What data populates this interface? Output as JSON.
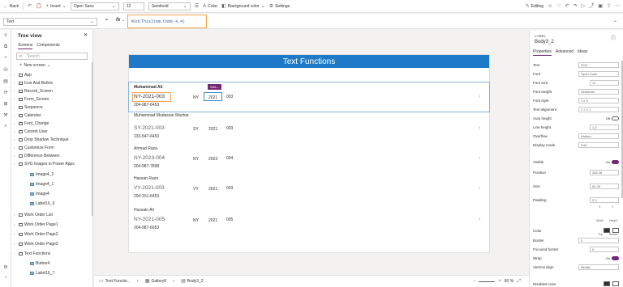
{
  "toolbar": {
    "back": "Back",
    "insert": "Insert",
    "font_value": "Open Sans",
    "size_value": "12",
    "weight_value": "Semibold",
    "color": "Color",
    "bg_color": "Background color",
    "settings": "Settings",
    "editing": "Editing"
  },
  "formula": {
    "property": "Text",
    "fx": "fx",
    "expression": "Mid(ThisItem.Code,4,4)"
  },
  "tree": {
    "title": "Tree view",
    "tabs": [
      "Screens",
      "Components"
    ],
    "search_placeholder": "Search",
    "new_screen": "New screen",
    "nodes": [
      {
        "label": "App",
        "type": "app"
      },
      {
        "label": "Icon And Button",
        "type": "screen"
      },
      {
        "label": "Record_Screen",
        "type": "screen"
      },
      {
        "label": "Form_Screen",
        "type": "screen"
      },
      {
        "label": "Sequence",
        "type": "screen"
      },
      {
        "label": "Calendar",
        "type": "screen"
      },
      {
        "label": "Font_Change",
        "type": "screen"
      },
      {
        "label": "Current User",
        "type": "screen"
      },
      {
        "label": "Drop Shadow Technique",
        "type": "screen"
      },
      {
        "label": "Customize Form",
        "type": "screen"
      },
      {
        "label": "Difference Between",
        "type": "screen"
      },
      {
        "label": "SVG Images in Power Apps",
        "type": "screen"
      },
      {
        "label": "Image4_2",
        "type": "image"
      },
      {
        "label": "Image4_1",
        "type": "image"
      },
      {
        "label": "Image4",
        "type": "image"
      },
      {
        "label": "Label16_6",
        "type": "image"
      },
      {
        "label": "Work Order List",
        "type": "screen"
      },
      {
        "label": "Work Order Page1",
        "type": "screen"
      },
      {
        "label": "Work Order Page2",
        "type": "screen"
      },
      {
        "label": "Work Order Page3",
        "type": "screen"
      },
      {
        "label": "Text Functions",
        "type": "screen"
      },
      {
        "label": "Button4",
        "type": "image"
      },
      {
        "label": "Label16_7",
        "type": "image"
      }
    ]
  },
  "screen": {
    "header": "Text Functions",
    "tag": "Edit",
    "rows": [
      {
        "name": "Muhammad Ali",
        "code": "NY-2021-003",
        "phone": "204-987-6453",
        "state": "NY",
        "year": "2021",
        "num": "003"
      },
      {
        "name": "Muhammad Mudassar Mazhar",
        "code": "SY-2021-003",
        "phone": "233-547-6453",
        "state": "SY",
        "year": "2021",
        "num": "003"
      },
      {
        "name": "Ahmad Raza",
        "code": "NY-2023-004",
        "phone": "204-987-7898",
        "state": "NY",
        "year": "2023",
        "num": "004"
      },
      {
        "name": "Hassan Raza",
        "code": "VY-2021-003",
        "phone": "204-151-6453",
        "state": "VY",
        "year": "2021",
        "num": "003"
      },
      {
        "name": "Hussain Ali",
        "code": "NY-2021-005",
        "phone": "204-987-6953",
        "state": "NY",
        "year": "2021",
        "num": "005"
      }
    ]
  },
  "status": {
    "crumbs": [
      "Text Functio...",
      "Gallery8",
      "Body3_2"
    ],
    "zoom": "60 %"
  },
  "props": {
    "type": "LABEL",
    "name": "Body3_2",
    "tabs": [
      "Properties",
      "Advanced",
      "Ideas"
    ],
    "rows": [
      {
        "label": "Text",
        "value": "2021"
      },
      {
        "label": "Font",
        "value": "Open Sans"
      },
      {
        "label": "Font size",
        "value": "12"
      },
      {
        "label": "Font weight",
        "value": "Semibold"
      },
      {
        "label": "Font style",
        "value": "/  U  S"
      },
      {
        "label": "Text alignment",
        "value": "≡ ≡ ≡ ≡"
      },
      {
        "label": "Auto height",
        "value": "Off"
      },
      {
        "label": "Line height",
        "value": "1.2"
      },
      {
        "label": "Overflow",
        "value": "Hidden"
      },
      {
        "label": "Display mode",
        "value": "Edit"
      },
      {
        "label": "Visible",
        "value": "On"
      },
      {
        "label": "Position",
        "value": "284  36"
      },
      {
        "label": "Size",
        "value": "64  28"
      },
      {
        "label": "Padding",
        "value": "0  0"
      },
      {
        "label": "Color",
        "value": ""
      },
      {
        "label": "Border",
        "value": "0"
      },
      {
        "label": "Focused border",
        "value": "0"
      },
      {
        "label": "Wrap",
        "value": "On"
      },
      {
        "label": "Vertical align",
        "value": "Middle"
      },
      {
        "label": "Disabled color",
        "value": ""
      }
    ],
    "sub_xy": [
      "X",
      "Y"
    ],
    "sub_wh": [
      "Width",
      "Height"
    ],
    "sub_tb": [
      "Top",
      "Bottom"
    ],
    "sub_lr": [
      "Left",
      "Right"
    ]
  },
  "colors": {
    "accent": "#742774",
    "header": "#1e7ac8",
    "highlight": "#f0a54a"
  }
}
